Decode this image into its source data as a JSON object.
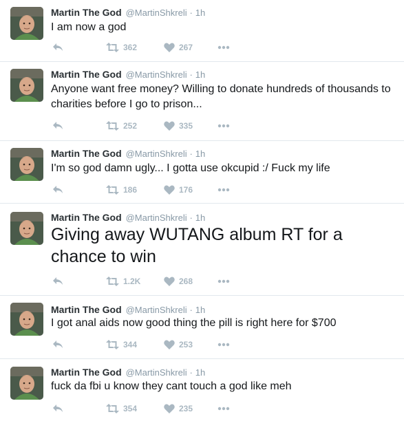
{
  "colors": {
    "text": "#14171a",
    "muted": "#8899a6",
    "action": "#aab8c2",
    "divider": "#e1e8ed",
    "avatar_bg": "#4a5a4a",
    "avatar_shirt": "#5b8f4e",
    "avatar_skin": "#d7a88a"
  },
  "icons": {
    "reply": "reply-icon",
    "retweet": "retweet-icon",
    "like": "heart-icon",
    "more": "more-dots-icon"
  },
  "tweets": [
    {
      "name": "Martin The God",
      "handle": "@MartinShkreli",
      "separator": "·",
      "time": "1h",
      "text": "I am now a god",
      "retweets": "362",
      "likes": "267"
    },
    {
      "name": "Martin The God",
      "handle": "@MartinShkreli",
      "separator": "·",
      "time": "1h",
      "text": "Anyone want free money? Willing to donate hundreds of thousands to charities before I go to prison...",
      "retweets": "252",
      "likes": "335"
    },
    {
      "name": "Martin The God",
      "handle": "@MartinShkreli",
      "separator": "·",
      "time": "1h",
      "text": "I'm so god damn ugly... I gotta use okcupid :/ Fuck my life",
      "retweets": "186",
      "likes": "176"
    },
    {
      "name": "Martin The God",
      "handle": "@MartinShkreli",
      "separator": "·",
      "time": "1h",
      "text": "Giving away WUTANG album RT for a chance to win",
      "retweets": "1.2K",
      "likes": "268"
    },
    {
      "name": "Martin The God",
      "handle": "@MartinShkreli",
      "separator": "·",
      "time": "1h",
      "text": "I got anal aids now good thing the pill is right here for $700",
      "retweets": "344",
      "likes": "253"
    },
    {
      "name": "Martin The God",
      "handle": "@MartinShkreli",
      "separator": "·",
      "time": "1h",
      "text": "fuck da fbi u know they cant touch a god like meh",
      "retweets": "354",
      "likes": "235"
    }
  ]
}
